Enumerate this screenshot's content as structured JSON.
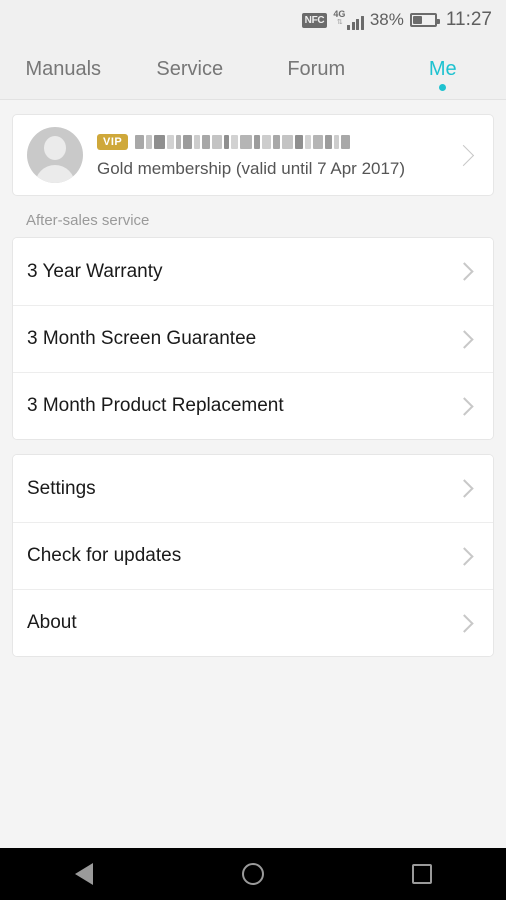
{
  "statusbar": {
    "nfc_label": "NFC",
    "network_type": "4G",
    "network_arrows": "⇅",
    "signal_bars": 4,
    "battery_percent": "38%",
    "battery_level": 38,
    "clock": "11:27"
  },
  "tabs": [
    {
      "label": "Manuals",
      "active": false
    },
    {
      "label": "Service",
      "active": false
    },
    {
      "label": "Forum",
      "active": false
    },
    {
      "label": "Me",
      "active": true
    }
  ],
  "profile": {
    "vip_badge": "VIP",
    "username_redacted": true,
    "membership": "Gold membership (valid until 7 Apr 2017)",
    "vip_color": "#cfa83a"
  },
  "sections": [
    {
      "title": "After-sales service",
      "items": [
        {
          "label": "3 Year Warranty"
        },
        {
          "label": "3 Month Screen Guarantee"
        },
        {
          "label": "3 Month Product Replacement"
        }
      ]
    },
    {
      "title": "",
      "items": [
        {
          "label": "Settings"
        },
        {
          "label": "Check for updates"
        },
        {
          "label": "About"
        }
      ]
    }
  ],
  "navbar": {
    "back": "back-button",
    "home": "home-button",
    "recents": "recents-button"
  },
  "colors": {
    "accent": "#1ec2d0",
    "background": "#f4f4f4",
    "card": "#ffffff",
    "text_primary": "#1a1a1a",
    "text_secondary": "#777777"
  }
}
